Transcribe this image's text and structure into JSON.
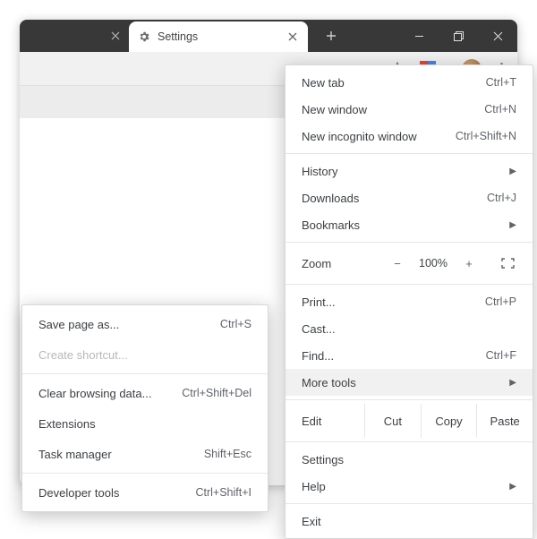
{
  "titlebar": {
    "active_tab_title": "Settings"
  },
  "main_menu": {
    "new_tab": {
      "label": "New tab",
      "shortcut": "Ctrl+T"
    },
    "new_window": {
      "label": "New window",
      "shortcut": "Ctrl+N"
    },
    "new_incognito": {
      "label": "New incognito window",
      "shortcut": "Ctrl+Shift+N"
    },
    "history": {
      "label": "History"
    },
    "downloads": {
      "label": "Downloads",
      "shortcut": "Ctrl+J"
    },
    "bookmarks": {
      "label": "Bookmarks"
    },
    "zoom": {
      "label": "Zoom",
      "minus": "−",
      "value": "100%",
      "plus": "+"
    },
    "print": {
      "label": "Print...",
      "shortcut": "Ctrl+P"
    },
    "cast": {
      "label": "Cast..."
    },
    "find": {
      "label": "Find...",
      "shortcut": "Ctrl+F"
    },
    "more_tools": {
      "label": "More tools"
    },
    "edit": {
      "label": "Edit",
      "cut": "Cut",
      "copy": "Copy",
      "paste": "Paste"
    },
    "settings": {
      "label": "Settings"
    },
    "help": {
      "label": "Help"
    },
    "exit": {
      "label": "Exit"
    }
  },
  "sub_menu": {
    "save_page": {
      "label": "Save page as...",
      "shortcut": "Ctrl+S"
    },
    "create_shortcut": {
      "label": "Create shortcut..."
    },
    "clear_data": {
      "label": "Clear browsing data...",
      "shortcut": "Ctrl+Shift+Del"
    },
    "extensions": {
      "label": "Extensions"
    },
    "task_manager": {
      "label": "Task manager",
      "shortcut": "Shift+Esc"
    },
    "dev_tools": {
      "label": "Developer tools",
      "shortcut": "Ctrl+Shift+I"
    }
  }
}
